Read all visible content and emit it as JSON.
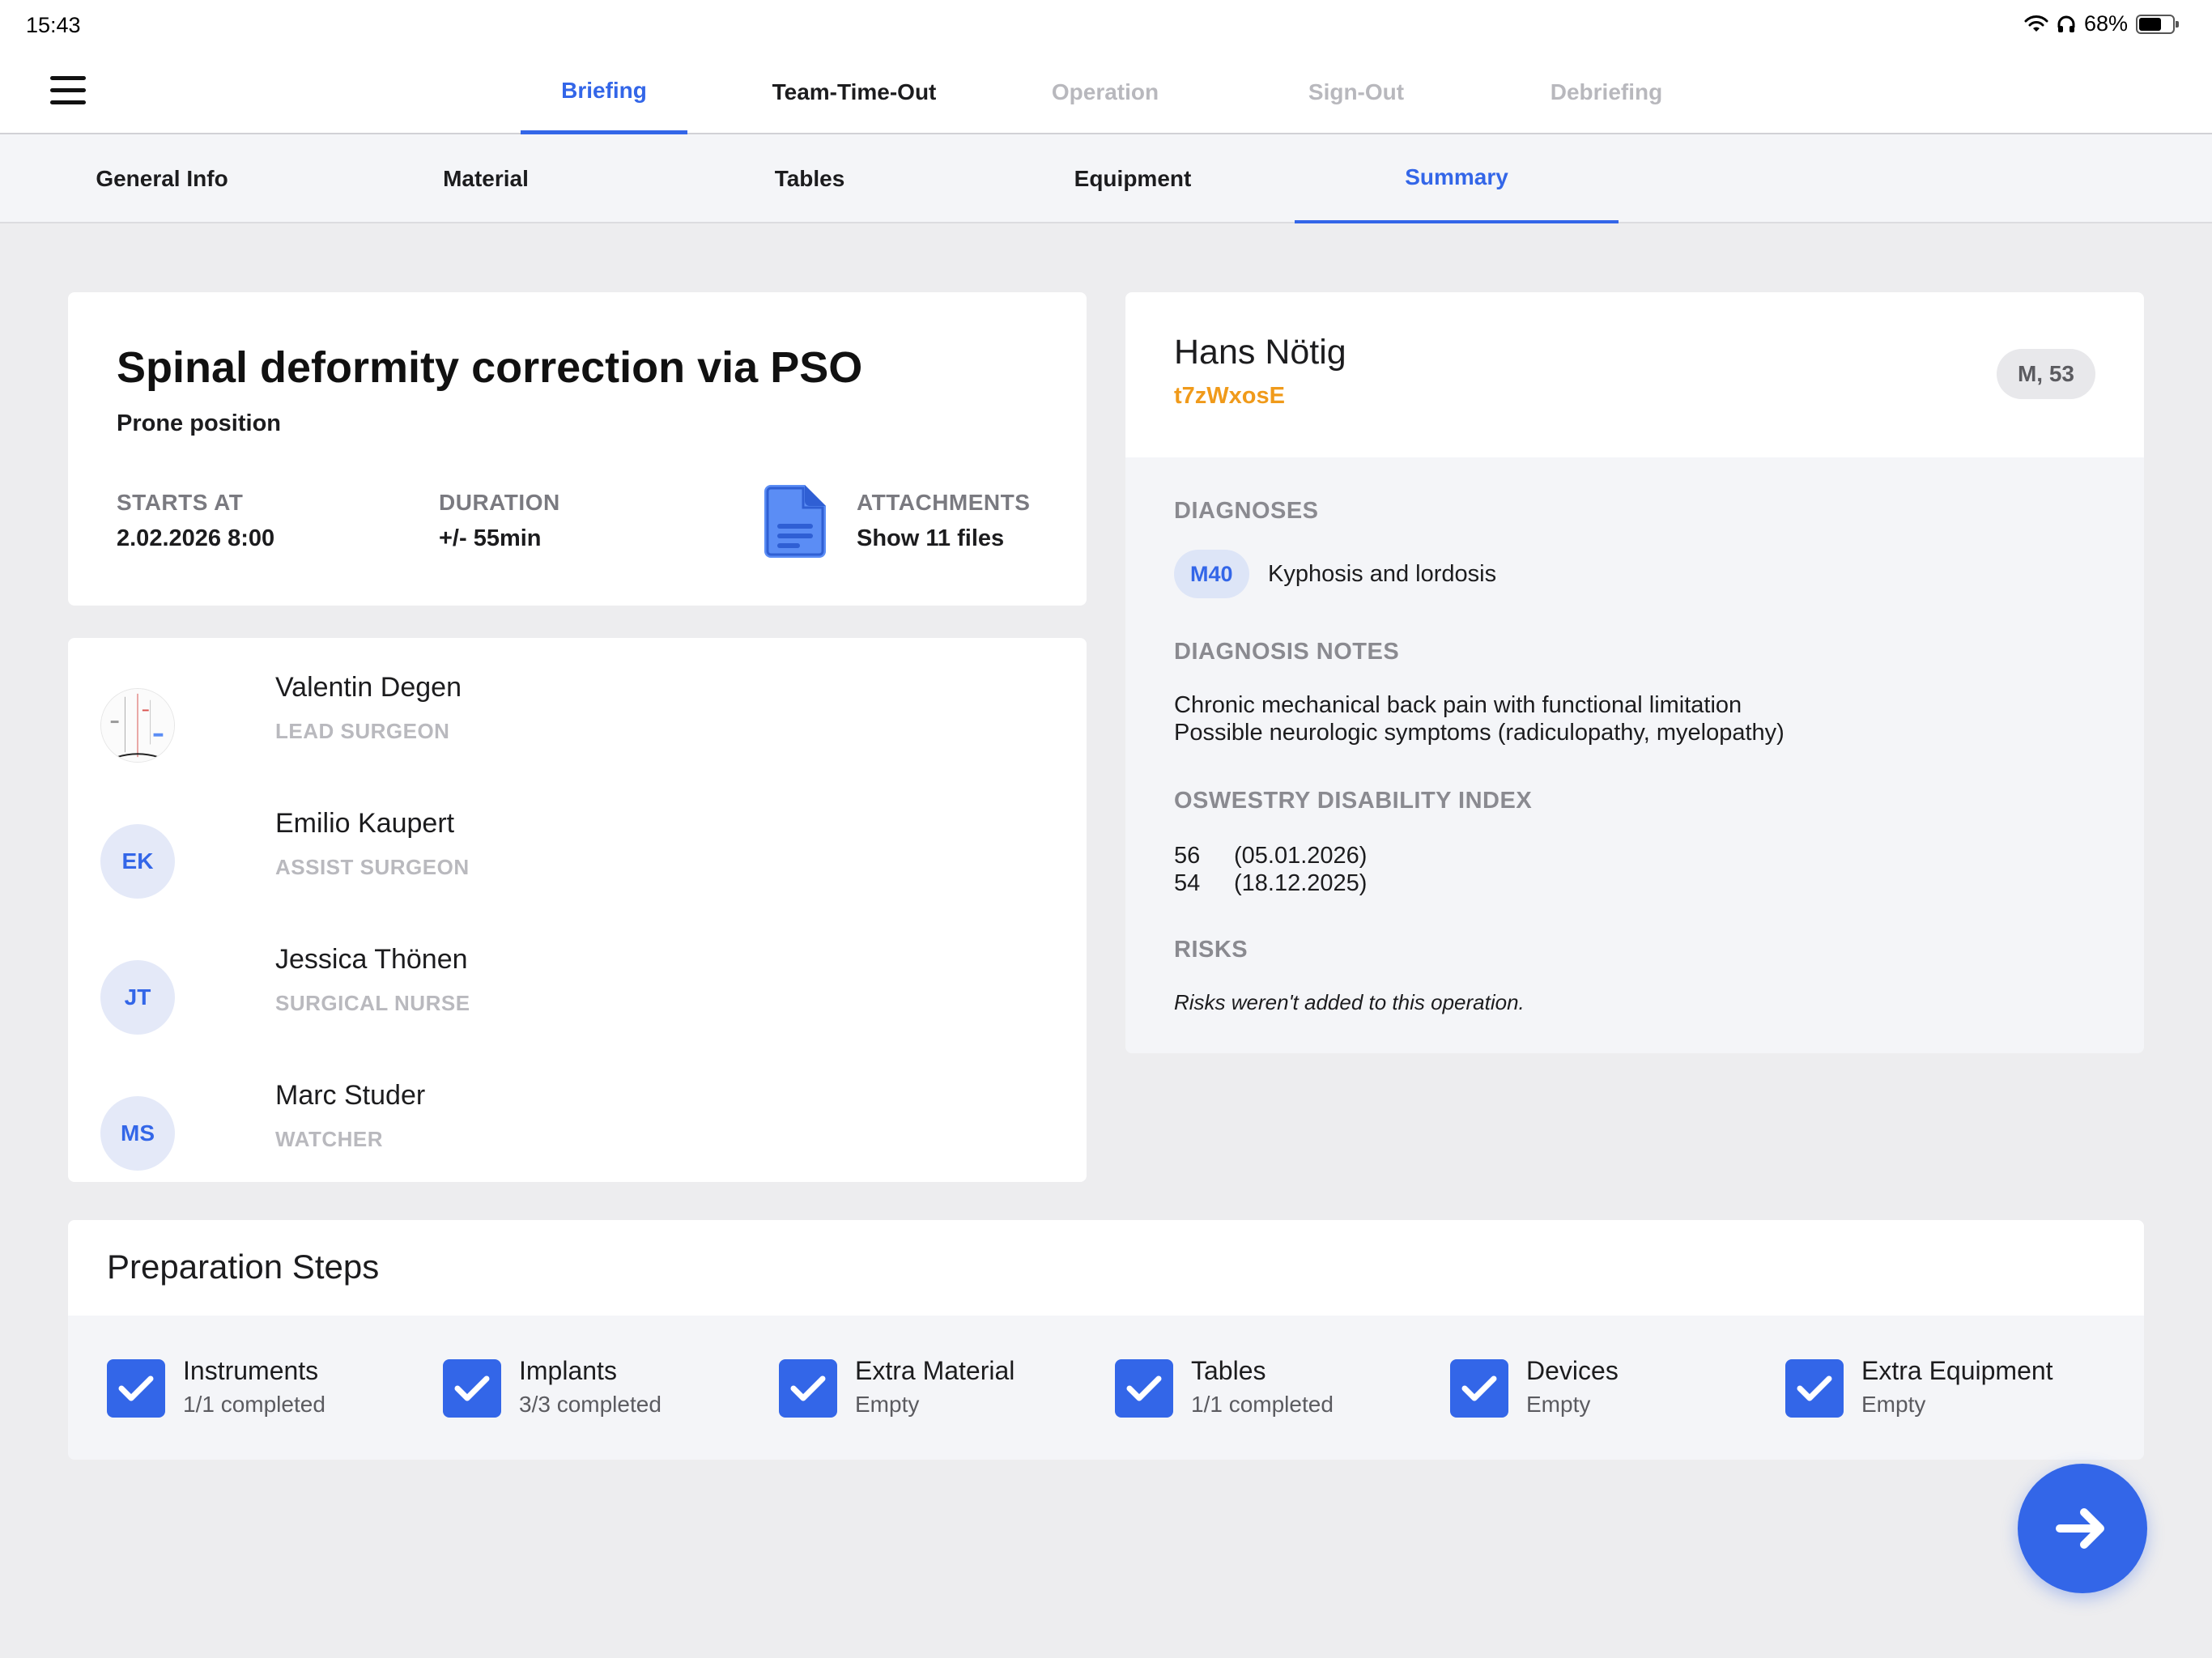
{
  "status_bar": {
    "time": "15:43",
    "battery": "68%",
    "battery_level": 0.68
  },
  "main_tabs": [
    {
      "label": "Briefing",
      "state": "active"
    },
    {
      "label": "Team-Time-Out",
      "state": "enabled"
    },
    {
      "label": "Operation",
      "state": "disabled"
    },
    {
      "label": "Sign-Out",
      "state": "disabled"
    },
    {
      "label": "Debriefing",
      "state": "disabled"
    }
  ],
  "sub_tabs": [
    {
      "label": "General Info"
    },
    {
      "label": "Material"
    },
    {
      "label": "Tables"
    },
    {
      "label": "Equipment"
    },
    {
      "label": "Summary",
      "active": true
    }
  ],
  "operation": {
    "title": "Spinal deformity correction via PSO",
    "position": "Prone position",
    "starts_at_label": "STARTS AT",
    "starts_at_value": "2.02.2026 8:00",
    "duration_label": "DURATION",
    "duration_value": "+/- 55min",
    "attachments_label": "ATTACHMENTS",
    "attachments_value": "Show 11 files"
  },
  "team": [
    {
      "initials": "",
      "photo": true,
      "name": "Valentin Degen",
      "role": "LEAD SURGEON"
    },
    {
      "initials": "EK",
      "name": "Emilio Kaupert",
      "role": "ASSIST SURGEON"
    },
    {
      "initials": "JT",
      "name": "Jessica Thönen",
      "role": "SURGICAL NURSE"
    },
    {
      "initials": "MS",
      "name": "Marc Studer",
      "role": "WATCHER"
    }
  ],
  "patient": {
    "name": "Hans Nötig",
    "id": "t7zWxosE",
    "badge": "M, 53",
    "diagnoses_label": "DIAGNOSES",
    "diagnosis_code": "M40",
    "diagnosis_text": "Kyphosis and lordosis",
    "notes_label": "DIAGNOSIS NOTES",
    "notes_line1": "Chronic mechanical back pain with functional limitation",
    "notes_line2": "Possible neurologic symptoms (radiculopathy, myelopathy)",
    "odi_label": "OSWESTRY DISABILITY INDEX",
    "odi": [
      {
        "value": "56",
        "date": "(05.01.2026)"
      },
      {
        "value": "54",
        "date": "(18.12.2025)"
      }
    ],
    "risks_label": "RISKS",
    "risks_text": "Risks weren't added to this operation."
  },
  "preparation": {
    "title": "Preparation Steps",
    "steps": [
      {
        "name": "Instruments",
        "status": "1/1 completed",
        "checked": true
      },
      {
        "name": "Implants",
        "status": "3/3 completed",
        "checked": true
      },
      {
        "name": "Extra Material",
        "status": "Empty",
        "checked": true
      },
      {
        "name": "Tables",
        "status": "1/1 completed",
        "checked": true
      },
      {
        "name": "Devices",
        "status": "Empty",
        "checked": true
      },
      {
        "name": "Extra Equipment",
        "status": "Empty",
        "checked": true
      }
    ]
  },
  "icons": {
    "menu": "hamburger-icon",
    "attachments": "document-icon",
    "next": "arrow-right-icon",
    "wifi": "wifi-icon",
    "headphones": "headphones-icon",
    "battery": "battery-icon"
  },
  "colors": {
    "accent": "#3366e8",
    "patient_id": "#f09a1a",
    "background": "#ededef"
  }
}
